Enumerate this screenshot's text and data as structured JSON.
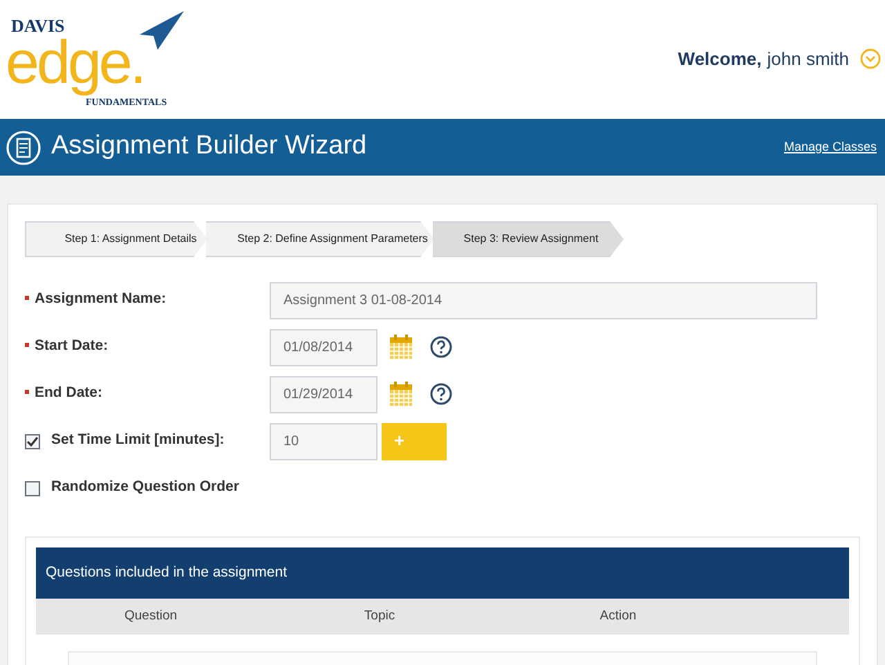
{
  "logo": {
    "top": "DAVIS",
    "main": "edge.",
    "bottom": "FUNDAMENTALS"
  },
  "user": {
    "greeting": "Welcome,",
    "name": "john smith"
  },
  "title_bar": {
    "title": "Assignment Builder Wizard",
    "link": "Manage Classes"
  },
  "steps": [
    {
      "label": "Step 1: Assignment Details",
      "selected": false
    },
    {
      "label": "Step 2: Define Assignment Parameters",
      "selected": false
    },
    {
      "label": "Step 3: Review Assignment",
      "selected": true
    }
  ],
  "fields": [
    {
      "kind": "text",
      "required": true,
      "label": "Assignment Name:",
      "value": "Assignment 3 01-08-2014"
    },
    {
      "kind": "date",
      "required": true,
      "label": "Start Date:",
      "value": "01/08/2014"
    },
    {
      "kind": "date",
      "required": true,
      "label": "End Date:",
      "value": "01/29/2014"
    },
    {
      "kind": "time",
      "checked": true,
      "label": "Set Time Limit [minutes]:",
      "value": "10",
      "button": "+"
    },
    {
      "kind": "check",
      "checked": false,
      "label": "Randomize Question Order"
    }
  ],
  "questions_table": {
    "title": "Questions included in the assignment",
    "columns": [
      "Question",
      "Topic",
      "Action"
    ]
  }
}
